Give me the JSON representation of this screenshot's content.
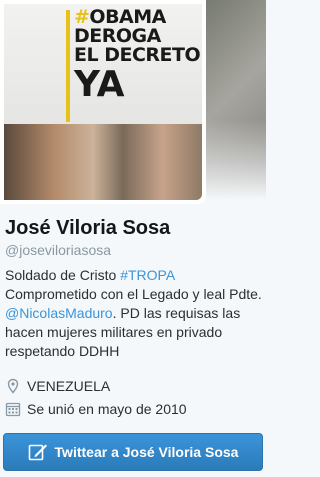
{
  "profile": {
    "name": "José Viloria Sosa",
    "handle": "@joseviloriasosa",
    "bio": {
      "text1": "Soldado de Cristo ",
      "hashtag": "#TROPA",
      "text2": " Comprometido con el Legado y leal Pdte. ",
      "mention": "@NicolasMaduro",
      "text3": ". PD las requisas las hacen mujeres militares en privado respetando DDHH"
    },
    "location": "VENEZUELA",
    "joined": "Se unió en mayo de 2010"
  },
  "avatar": {
    "line1_hash": "#",
    "line1": "OBAMA",
    "line2": "DEROGA",
    "line3": "EL DECRETO",
    "line4": "YA"
  },
  "tweet_button": {
    "label": "Twittear a José Viloria Sosa"
  },
  "icons": {
    "location": "location-pin-icon",
    "joined": "calendar-icon",
    "compose": "compose-tweet-icon"
  },
  "colors": {
    "link": "#3b94d9",
    "button": "#2b7bb9",
    "accent_yellow": "#e8c21b"
  }
}
